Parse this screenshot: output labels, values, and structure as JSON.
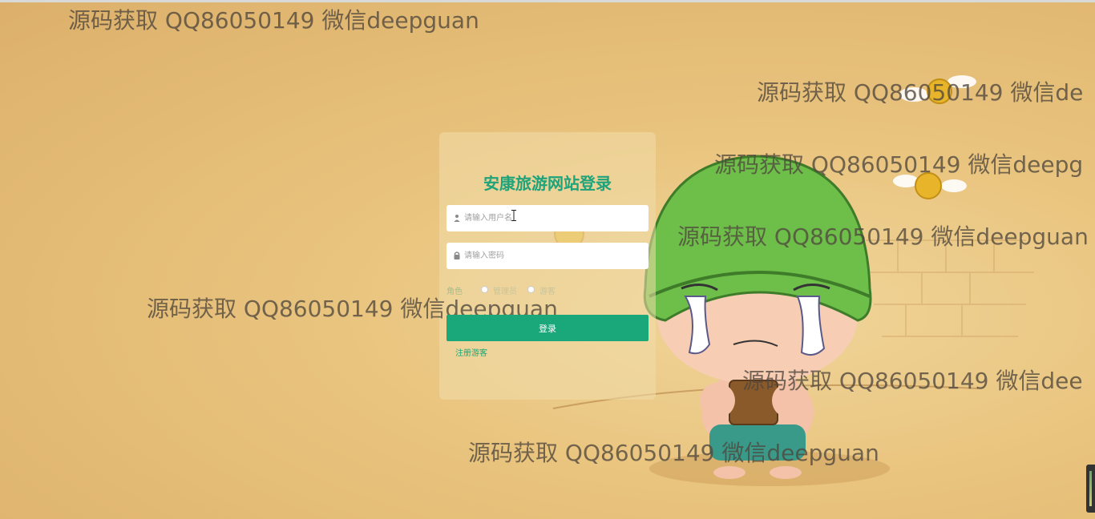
{
  "login": {
    "title": "安康旅游网站登录",
    "username_placeholder": "请输入用户名",
    "password_placeholder": "请输入密码",
    "role_label": "角色",
    "roles": [
      "管理员",
      "游客"
    ],
    "login_button": "登录",
    "register_link": "注册游客"
  },
  "watermarks": [
    "源码获取 QQ86050149 微信deepguan",
    "源码获取 QQ86050149 微信de",
    "源码获取 QQ86050149 微信deepg",
    "源码获取 QQ86050149 微信deepguan",
    "源码获取 QQ86050149 微信deepguan",
    "源码获取 QQ86050149 微信dee",
    "源码获取 QQ86050149 微信deepguan"
  ],
  "colors": {
    "accent": "#1aa87a",
    "title": "#1ea37b",
    "background": "#e9c47e"
  },
  "icons": [
    "user-icon",
    "lock-icon"
  ]
}
